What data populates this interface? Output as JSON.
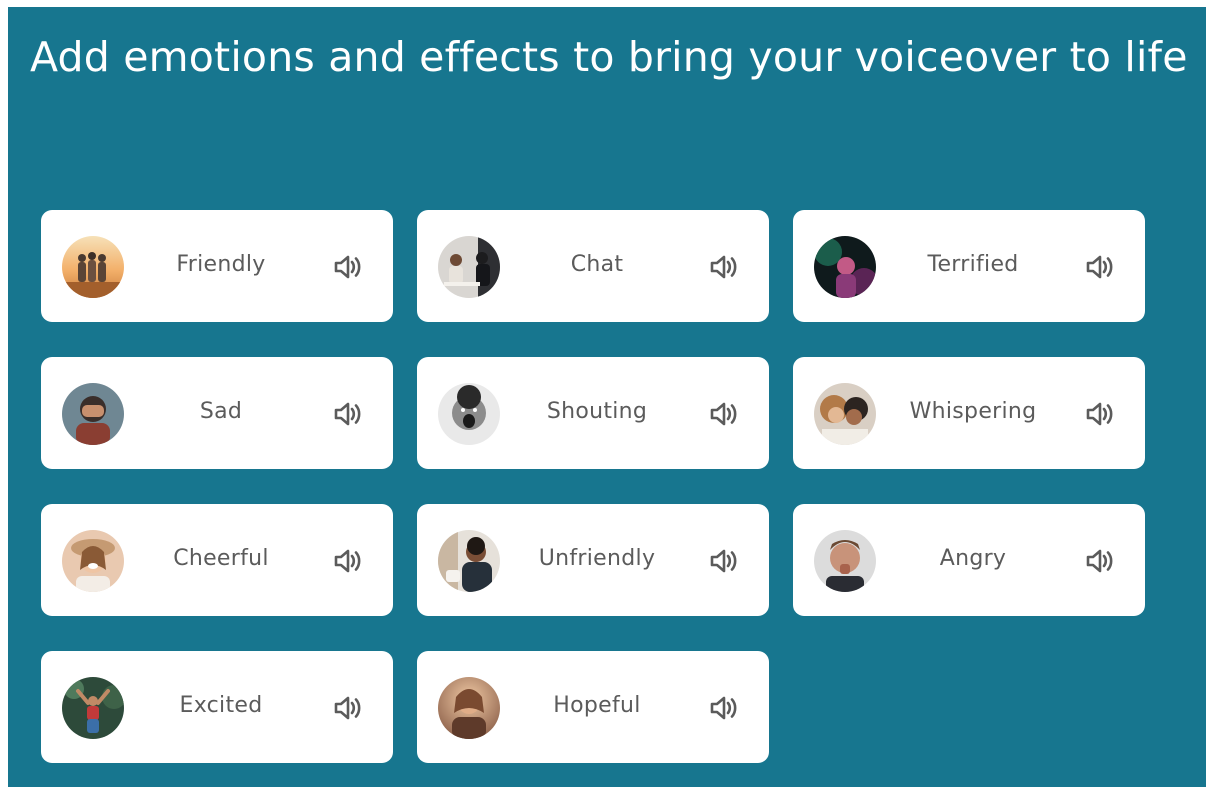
{
  "heading": "Add emotions and effects to bring your voiceover to life",
  "colors": {
    "panel_background": "#17768f",
    "card_background": "#ffffff",
    "label_text": "#5b5b5b",
    "speaker_icon": "#5b5b5b"
  },
  "emotions": [
    {
      "label": "Friendly",
      "avatar_icon": "friends-group-photo",
      "speaker_icon": "speaker-icon"
    },
    {
      "label": "Chat",
      "avatar_icon": "people-chatting-photo",
      "speaker_icon": "speaker-icon"
    },
    {
      "label": "Terrified",
      "avatar_icon": "terrified-person-photo",
      "speaker_icon": "speaker-icon"
    },
    {
      "label": "Sad",
      "avatar_icon": "sad-person-photo",
      "speaker_icon": "speaker-icon"
    },
    {
      "label": "Shouting",
      "avatar_icon": "shouting-man-photo",
      "speaker_icon": "speaker-icon"
    },
    {
      "label": "Whispering",
      "avatar_icon": "whispering-people-photo",
      "speaker_icon": "speaker-icon"
    },
    {
      "label": "Cheerful",
      "avatar_icon": "cheerful-woman-photo",
      "speaker_icon": "speaker-icon"
    },
    {
      "label": "Unfriendly",
      "avatar_icon": "unfriendly-man-photo",
      "speaker_icon": "speaker-icon"
    },
    {
      "label": "Angry",
      "avatar_icon": "angry-man-photo",
      "speaker_icon": "speaker-icon"
    },
    {
      "label": "Excited",
      "avatar_icon": "excited-person-photo",
      "speaker_icon": "speaker-icon"
    },
    {
      "label": "Hopeful",
      "avatar_icon": "hopeful-woman-photo",
      "speaker_icon": "speaker-icon"
    }
  ]
}
